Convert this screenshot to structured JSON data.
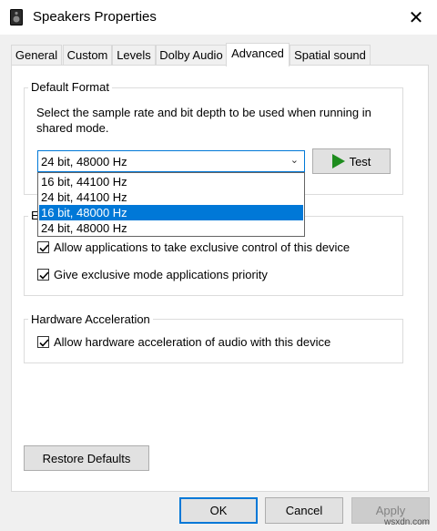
{
  "window": {
    "title": "Speakers Properties",
    "close_symbol": "✕",
    "icon": "speaker-icon"
  },
  "tabs": [
    {
      "label": "General"
    },
    {
      "label": "Custom"
    },
    {
      "label": "Levels"
    },
    {
      "label": "Dolby Audio"
    },
    {
      "label": "Advanced",
      "active": true
    },
    {
      "label": "Spatial sound"
    }
  ],
  "default_format": {
    "title": "Default Format",
    "description": "Select the sample rate and bit depth to be used when running in shared mode.",
    "selected": "24 bit, 48000 Hz",
    "options": [
      "16 bit, 44100 Hz",
      "24 bit, 44100 Hz",
      "16 bit, 48000 Hz",
      "24 bit, 48000 Hz"
    ],
    "highlighted": "16 bit, 48000 Hz",
    "test_label": "Test"
  },
  "exclusive_mode": {
    "title_partial": "E",
    "allow_exclusive": "Allow applications to take exclusive control of this device",
    "give_priority": "Give exclusive mode applications priority"
  },
  "hardware_acceleration": {
    "title": "Hardware Acceleration",
    "allow_hw": "Allow hardware acceleration of audio with this device"
  },
  "buttons": {
    "restore": "Restore Defaults",
    "ok": "OK",
    "cancel": "Cancel",
    "apply": "Apply"
  },
  "watermark": "wsxdn.com",
  "colors": {
    "accent": "#0078d7",
    "play": "#1e8c1e"
  }
}
